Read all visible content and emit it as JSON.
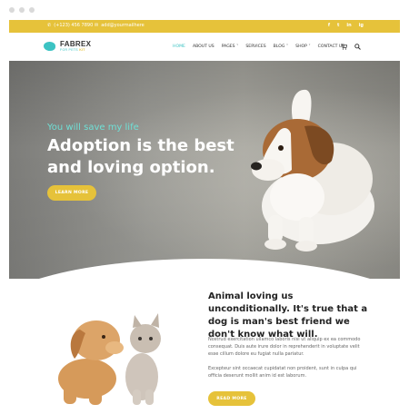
{
  "topbar": {
    "phone": "(+123) 456 7890",
    "email": "add@yourmailhere",
    "socials": [
      "f",
      "t",
      "in",
      "ig"
    ]
  },
  "header": {
    "logo_name": "FABREX",
    "logo_tag": "FOR PETS",
    "logo_tag_accent": "KIT"
  },
  "nav": {
    "items": [
      "HOME",
      "ABOUT US",
      "PAGES ˅",
      "SERVICES",
      "BLOG ˅",
      "SHOP ˅",
      "CONTACT US"
    ]
  },
  "hero": {
    "kicker": "You will save my life",
    "title": "Adoption is the best and loving option.",
    "button": "LEARN MORE"
  },
  "about": {
    "title": "Animal loving us unconditionally. It's true that a dog is man's best friend we don't know what will.",
    "p1": "Nostrud exercitation ullamco laboris nisi ut aliquip ex ea commodo consequat. Duis aute irure dolor in reprehenderit in voluptate velit esse cillum dolore eu fugiat nulla pariatur.",
    "p2": "Excepteur sint occaecat cupidatat non proident, sunt in culpa qui officia deserunt mollit anim id est laborum.",
    "button": "READ MORE"
  },
  "colors": {
    "accent_yellow": "#e6c23a",
    "accent_teal": "#3cc3c3"
  }
}
